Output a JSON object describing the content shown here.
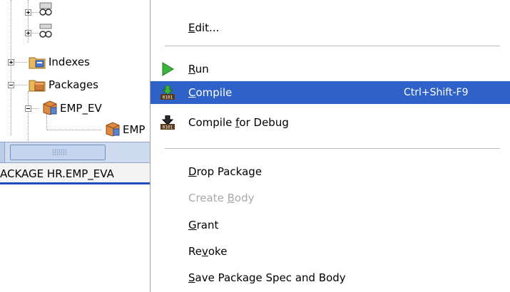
{
  "tree": {
    "nodes": [
      {
        "label": "Indexes",
        "icon": "indexes-folder-icon"
      },
      {
        "label": "Packages",
        "icon": "packages-folder-icon"
      },
      {
        "label": "EMP_EV",
        "icon": "package-icon"
      },
      {
        "label": "EMP",
        "icon": "package-spec-icon"
      }
    ]
  },
  "editor_tab": {
    "title": "ACKAGE HR.EMP_EVA"
  },
  "menu": {
    "edit": {
      "pre": "",
      "key": "E",
      "post": "dit..."
    },
    "run": {
      "pre": "",
      "key": "R",
      "post": "un"
    },
    "compile": {
      "pre": "",
      "key": "C",
      "post": "ompile",
      "shortcut": "Ctrl+Shift-F9"
    },
    "compile_debug": {
      "pre": "Compile ",
      "key": "f",
      "post": "or Debug"
    },
    "drop_package": {
      "pre": "",
      "key": "D",
      "post": "rop Package"
    },
    "create_body": {
      "pre": "Create ",
      "key": "B",
      "post": "ody"
    },
    "grant": {
      "pre": "",
      "key": "G",
      "post": "rant"
    },
    "revoke": {
      "pre": "Re",
      "key": "v",
      "post": "oke"
    },
    "save_package": {
      "pre": "",
      "key": "S",
      "post": "ave Package Spec and Body"
    }
  },
  "colors": {
    "selection": "#2f62c8",
    "run_icon": "#3cb43c",
    "tab_underline": "#1f4fbf"
  }
}
